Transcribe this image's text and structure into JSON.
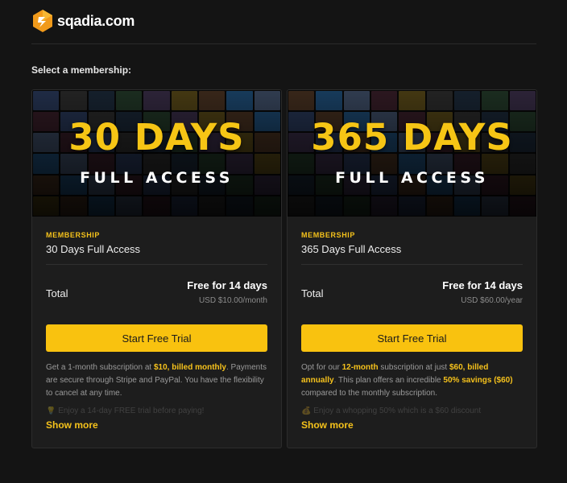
{
  "brand": {
    "name": "sqadia.com"
  },
  "heading": "Select a membership:",
  "plans": [
    {
      "banner_big": "30 DAYS",
      "banner_small": "FULL ACCESS",
      "kicker": "MEMBERSHIP",
      "title": "30 Days Full Access",
      "total_label": "Total",
      "price_main": "Free for 14 days",
      "price_sub": "USD $10.00/month",
      "cta": "Start Free Trial",
      "desc": [
        {
          "t": "Get a 1-month subscription at "
        },
        {
          "t": "$10, billed monthly",
          "b": true
        },
        {
          "t": ". Payments are secure through Stripe and PayPal. You have the flexibility to cancel at any time."
        }
      ],
      "faded_text": "Enjoy a 14-day FREE trial before paying!",
      "faded_icon": "lightbulb-icon",
      "show_more": "Show more"
    },
    {
      "banner_big": "365 DAYS",
      "banner_small": "FULL ACCESS",
      "kicker": "MEMBERSHIP",
      "title": "365 Days Full Access",
      "total_label": "Total",
      "price_main": "Free for 14 days",
      "price_sub": "USD $60.00/year",
      "cta": "Start Free Trial",
      "desc": [
        {
          "t": "Opt for our "
        },
        {
          "t": "12-month",
          "b": true
        },
        {
          "t": " subscription at just "
        },
        {
          "t": "$60, billed annually",
          "b": true
        },
        {
          "t": ". This plan offers an incredible "
        },
        {
          "t": "50% savings ($60)",
          "b": true
        },
        {
          "t": " compared to the monthly subscription."
        }
      ],
      "faded_text": "Enjoy a whopping 50% which is a $60 discount",
      "faded_icon": "money-bag-icon",
      "show_more": "Show more"
    }
  ],
  "colors": {
    "accent": "#f9c20f",
    "background": "#141414",
    "card": "#1d1d1d"
  }
}
